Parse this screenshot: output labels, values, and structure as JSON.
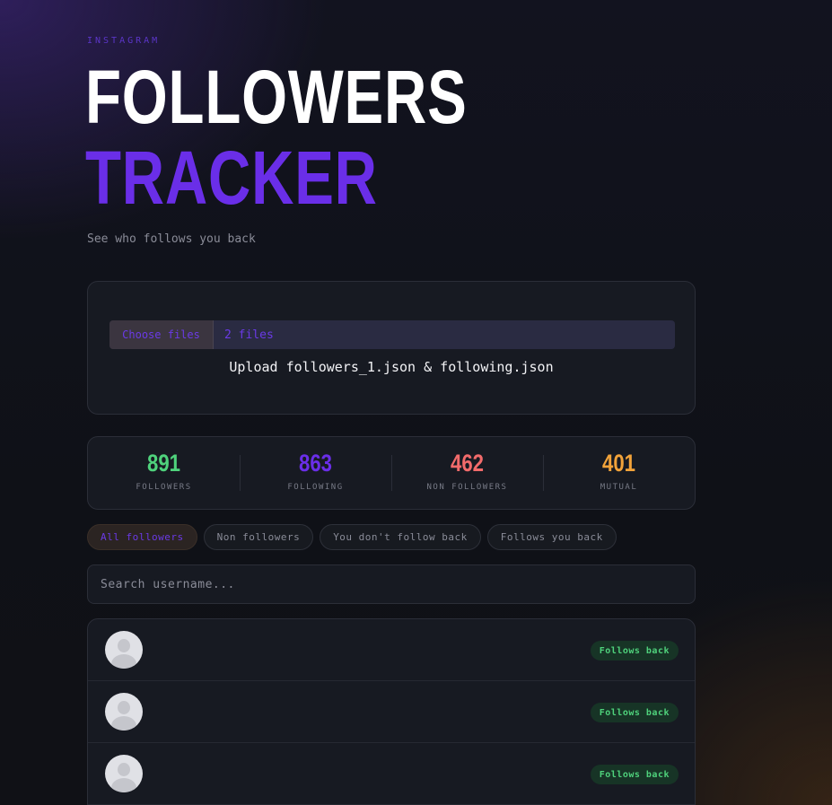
{
  "header": {
    "eyebrow": "INSTAGRAM",
    "title_line1": "FOLLOWERS",
    "title_line2": "TRACKER",
    "subtitle": "See who follows you back"
  },
  "upload": {
    "choose_label": "Choose files",
    "file_count": "2 files",
    "instruction": "Upload followers_1.json & following.json"
  },
  "stats": [
    {
      "value": "891",
      "label": "FOLLOWERS",
      "color": "#4fd27c"
    },
    {
      "value": "863",
      "label": "FOLLOWING",
      "color": "#6a2ee8"
    },
    {
      "value": "462",
      "label": "NON FOLLOWERS",
      "color": "#f26b6b"
    },
    {
      "value": "401",
      "label": "MUTUAL",
      "color": "#f2a33a"
    }
  ],
  "filters": [
    {
      "label": "All followers",
      "active": true
    },
    {
      "label": "Non followers",
      "active": false
    },
    {
      "label": "You don't follow back",
      "active": false
    },
    {
      "label": "Follows you back",
      "active": false
    }
  ],
  "search": {
    "placeholder": "Search username..."
  },
  "list": {
    "rows": [
      {
        "avatar": "default-avatar-icon",
        "badge": "Follows back"
      },
      {
        "avatar": "default-avatar-icon",
        "badge": "Follows back"
      },
      {
        "avatar": "default-avatar-icon",
        "badge": "Follows back"
      }
    ]
  },
  "colors": {
    "accent": "#6a2ee8",
    "background": "#0f1117",
    "card": "#171a22",
    "success": "#4fd27c"
  }
}
